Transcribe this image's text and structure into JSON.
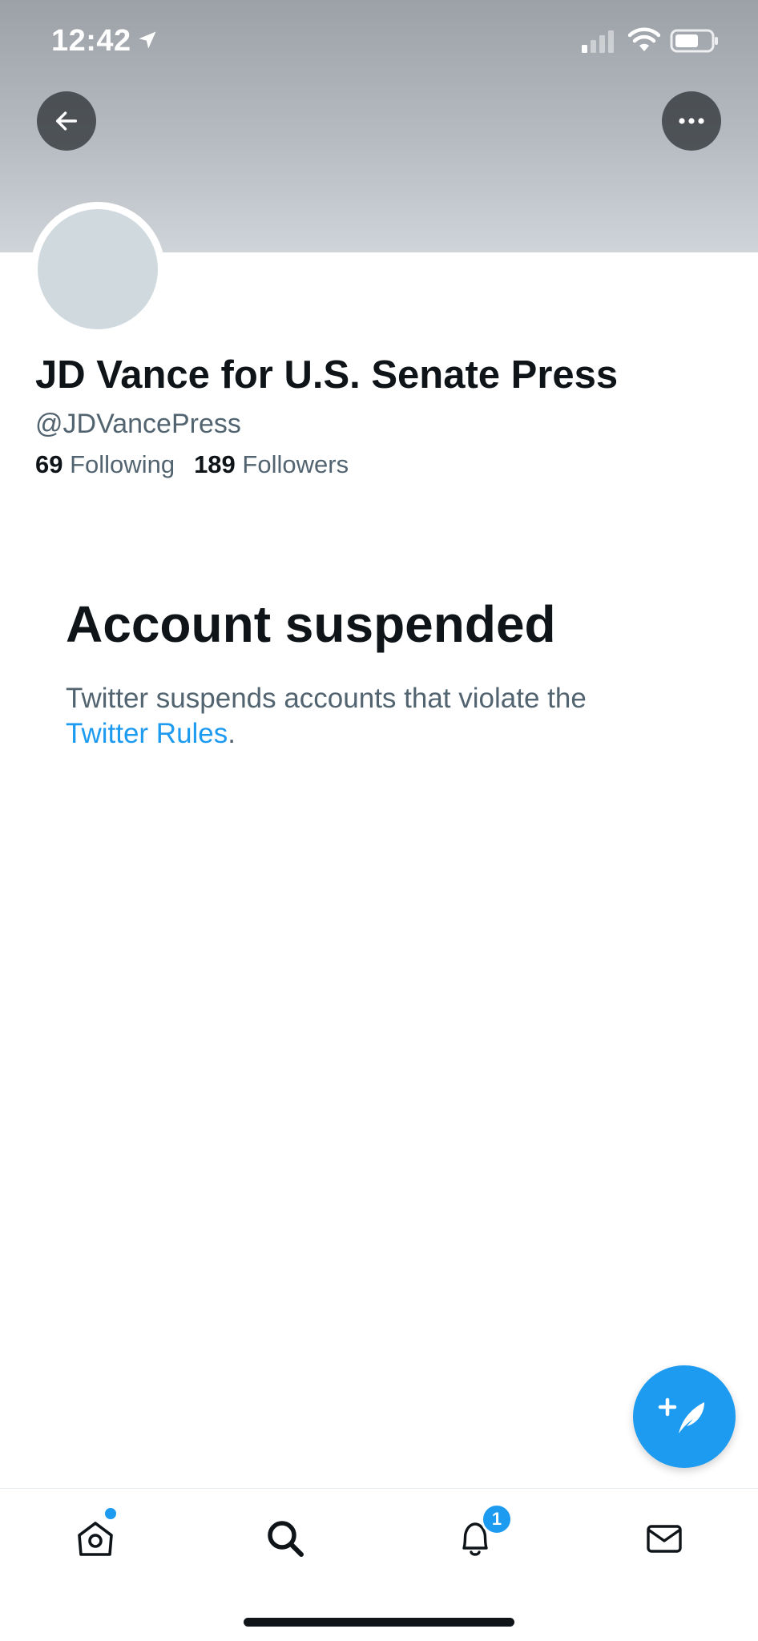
{
  "status_bar": {
    "time": "12:42",
    "icons": [
      "location-arrow-icon",
      "cellular-signal-icon",
      "wifi-icon",
      "battery-icon"
    ]
  },
  "header": {
    "back_icon": "arrow-left-icon",
    "more_icon": "ellipsis-icon"
  },
  "profile": {
    "display_name": "JD Vance for U.S. Senate Press",
    "handle": "@JDVancePress",
    "following_count": "69",
    "following_label": "Following",
    "followers_count": "189",
    "followers_label": "Followers"
  },
  "suspension": {
    "title": "Account suspended",
    "body_text": "Twitter suspends accounts that violate the ",
    "link_text": "Twitter Rules",
    "trailing": "."
  },
  "fab": {
    "icon": "compose-feather-plus-icon"
  },
  "tabbar": {
    "items": [
      {
        "name": "home",
        "icon": "home-icon"
      },
      {
        "name": "search",
        "icon": "search-icon"
      },
      {
        "name": "notifications",
        "icon": "bell-icon"
      },
      {
        "name": "messages",
        "icon": "mail-icon"
      }
    ],
    "notification_badge": "1"
  },
  "colors": {
    "accent": "#1d9bf0",
    "text_primary": "#0f1419",
    "text_secondary": "#536471",
    "avatar_placeholder": "#cfd9de"
  }
}
